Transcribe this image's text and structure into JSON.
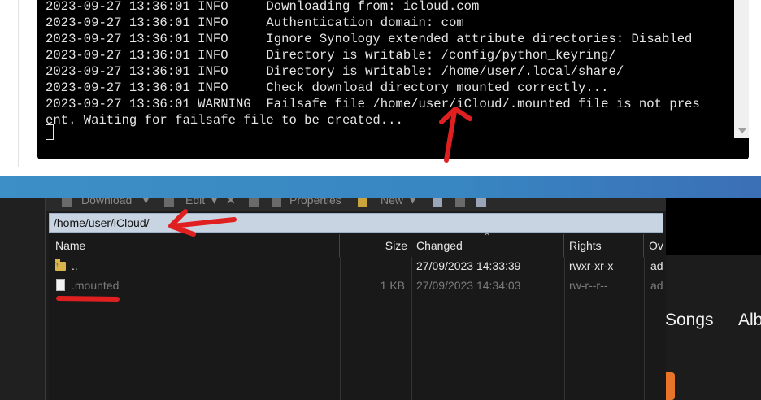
{
  "terminal": {
    "lines": [
      "2023-09-27 13:36:01 INFO     Downloading from: icloud.com",
      "2023-09-27 13:36:01 INFO     Authentication domain: com",
      "2023-09-27 13:36:01 INFO     Ignore Synology extended attribute directories: Disabled",
      "2023-09-27 13:36:01 INFO     Directory is writable: /config/python_keyring/",
      "2023-09-27 13:36:01 INFO     Directory is writable: /home/user/.local/share/",
      "2023-09-27 13:36:01 INFO     Check download directory mounted correctly...",
      "2023-09-27 13:36:01 WARNING  Failsafe file /home/user/iCloud/.mounted file is not pres",
      "ent. Waiting for failsafe file to be created..."
    ]
  },
  "file_manager": {
    "toolbar": {
      "download": "Download",
      "edit": "Edit",
      "properties": "Properties",
      "new": "New"
    },
    "path": "/home/user/iCloud/",
    "columns": [
      "Name",
      "Size",
      "Changed",
      "Rights",
      "Ov"
    ],
    "rows": [
      {
        "name": "..",
        "size": "",
        "changed": "27/09/2023 14:33:39",
        "rights": "rwxr-xr-x",
        "owner": "ad"
      },
      {
        "name": ".mounted",
        "size": "1 KB",
        "changed": "27/09/2023 14:34:03",
        "rights": "rw-r--r--",
        "owner": "ad"
      }
    ]
  },
  "background_app": {
    "tabs": [
      "Songs",
      "Alb"
    ]
  },
  "colors": {
    "annotation": "#e02020",
    "terminal_bg": "#000000",
    "path_bar": "#c9d4e2",
    "desktop_blue": "#3886c2"
  }
}
